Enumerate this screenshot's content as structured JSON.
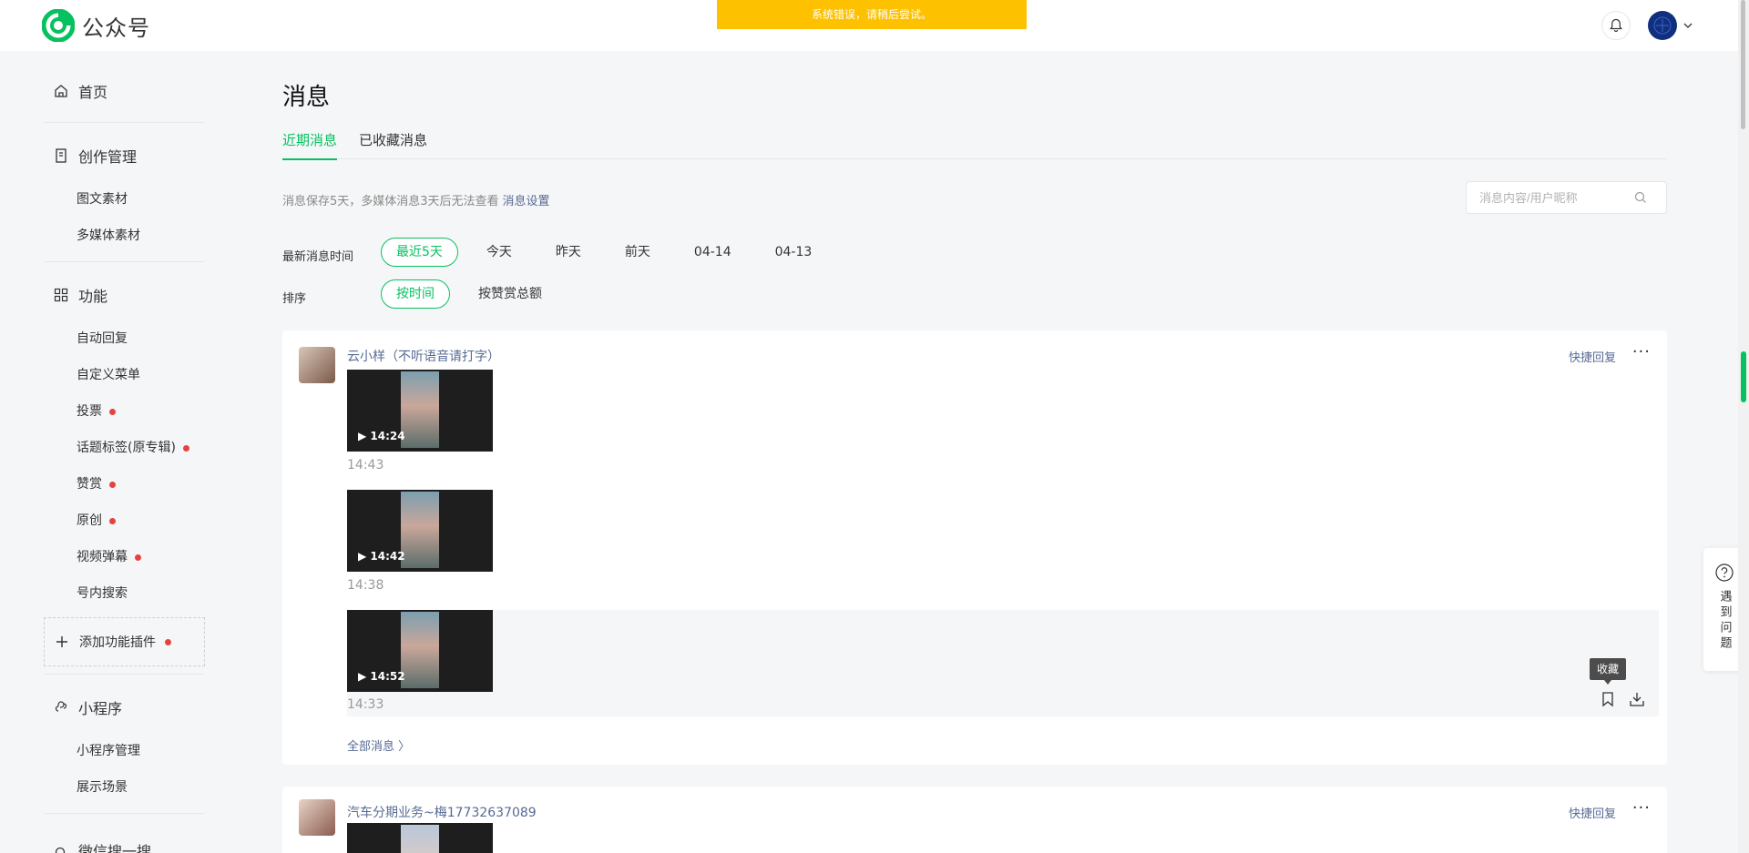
{
  "header": {
    "logo_text": "公众号",
    "error_banner": "系统错误，请稍后尝试。"
  },
  "sidebar": {
    "home": "首页",
    "creation": {
      "title": "创作管理",
      "items": [
        "图文素材",
        "多媒体素材"
      ]
    },
    "features": {
      "title": "功能",
      "items": [
        {
          "label": "自动回复",
          "dot": false
        },
        {
          "label": "自定义菜单",
          "dot": false
        },
        {
          "label": "投票",
          "dot": true
        },
        {
          "label": "话题标签(原专辑)",
          "dot": true
        },
        {
          "label": "赞赏",
          "dot": true
        },
        {
          "label": "原创",
          "dot": true
        },
        {
          "label": "视频弹幕",
          "dot": true
        },
        {
          "label": "号内搜索",
          "dot": false
        }
      ]
    },
    "add_plugin": "添加功能插件",
    "miniprogram": {
      "title": "小程序",
      "items": [
        "小程序管理",
        "展示场景"
      ]
    },
    "wechat_search": "微信搜一搜"
  },
  "main": {
    "title": "消息",
    "tabs": [
      "近期消息",
      "已收藏消息"
    ],
    "hint": "消息保存5天，多媒体消息3天后无法查看",
    "hint_link": "消息设置",
    "search_placeholder": "消息内容/用户昵称",
    "filter_time_label": "最新消息时间",
    "filter_time_options": [
      "最近5天",
      "今天",
      "昨天",
      "前天",
      "04-14",
      "04-13"
    ],
    "sort_label": "排序",
    "sort_options": [
      "按时间",
      "按赞赏总额"
    ]
  },
  "messages": [
    {
      "name": "云小样（不听语音请打字）",
      "quick_reply": "快捷回复",
      "more": "···",
      "videos": [
        {
          "duration": "▶ 14:24",
          "time": "14:43"
        },
        {
          "duration": "▶ 14:42",
          "time": "14:38"
        },
        {
          "duration": "▶ 14:52",
          "time": "14:33"
        }
      ],
      "tooltip": "收藏",
      "all_messages": "全部消息 〉"
    },
    {
      "name": "汽车分期业务~梅17732637089",
      "quick_reply": "快捷回复",
      "more": "···"
    }
  ],
  "help": {
    "text": "遇到问题"
  },
  "colors": {
    "accent": "#07c160",
    "link": "#576b95",
    "banner": "#fdc100",
    "dot": "#e64340"
  }
}
